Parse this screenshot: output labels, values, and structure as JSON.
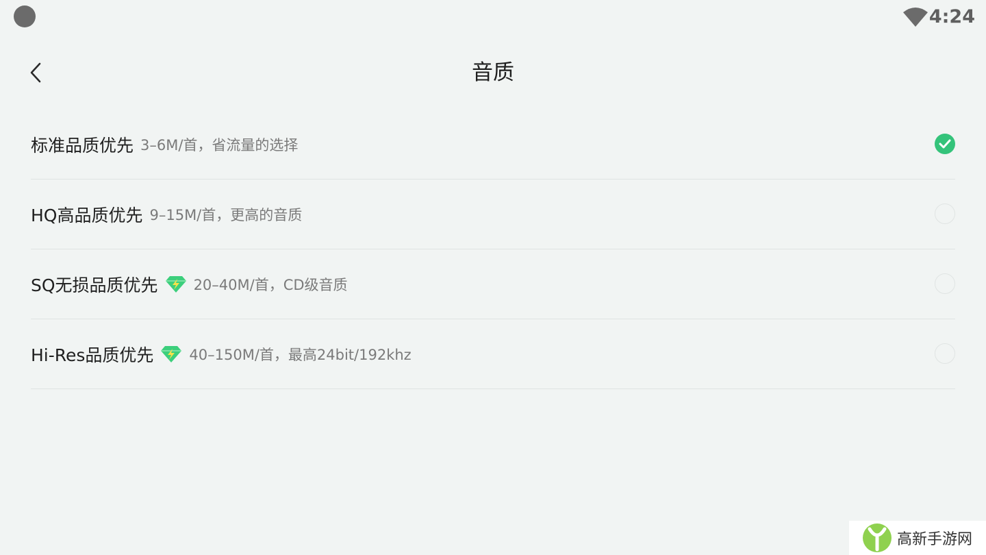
{
  "status_bar": {
    "time": "4:24",
    "icons": [
      "notification-dot-icon",
      "wifi-icon"
    ]
  },
  "header": {
    "back_icon": "chevron-left-icon",
    "title": "音质"
  },
  "options": [
    {
      "name": "标准品质优先",
      "desc": "3–6M/首，省流量的选择",
      "vip": false,
      "selected": true
    },
    {
      "name": "HQ高品质优先",
      "desc": "9–15M/首，更高的音质",
      "vip": false,
      "selected": false
    },
    {
      "name": "SQ无损品质优先",
      "desc": "20–40M/首，CD级音质",
      "vip": true,
      "selected": false
    },
    {
      "name": "Hi-Res品质优先",
      "desc": "40–150M/首，最高24bit/192khz",
      "vip": true,
      "selected": false
    }
  ],
  "colors": {
    "accent": "#34c37a",
    "background": "#f1f4f3",
    "diamond": "#3ccf7c"
  },
  "watermark": {
    "text": "高新手游网"
  }
}
